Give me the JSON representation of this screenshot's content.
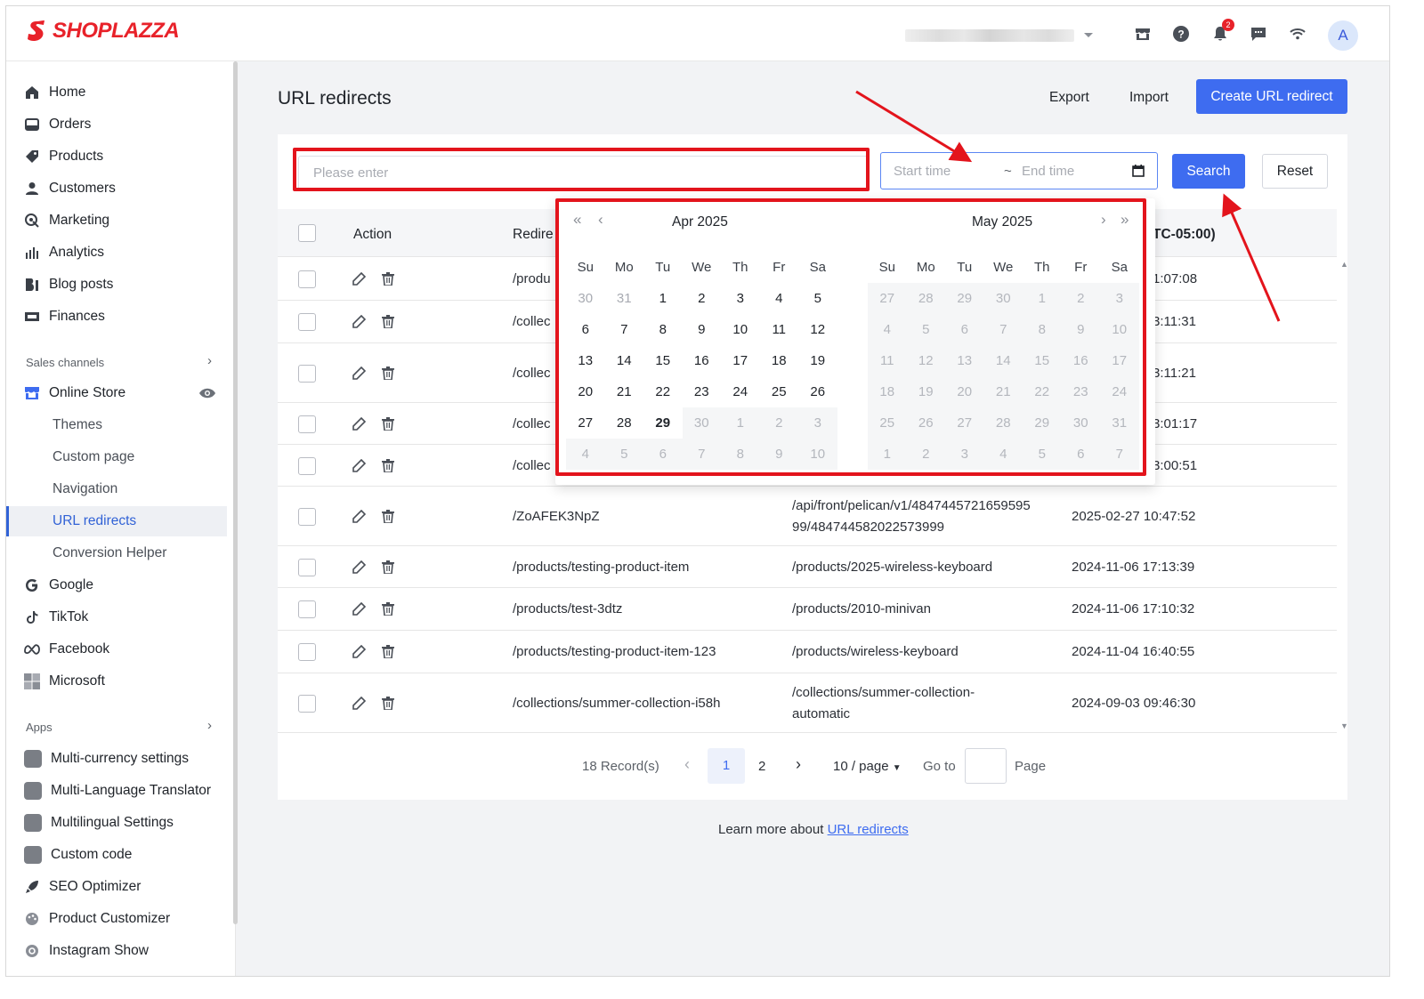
{
  "brand": {
    "name": "SHOPLAZZA",
    "color": "#e8222a"
  },
  "topbar": {
    "store_name": "",
    "notification_count": "2",
    "avatar_initial": "A",
    "icons": [
      "store-icon",
      "help-icon",
      "bell-icon",
      "chat-icon",
      "wifi-icon"
    ]
  },
  "sidebar": {
    "main_items": [
      {
        "label": "Home",
        "icon": "home-icon"
      },
      {
        "label": "Orders",
        "icon": "orders-icon"
      },
      {
        "label": "Products",
        "icon": "tag-icon"
      },
      {
        "label": "Customers",
        "icon": "person-icon"
      },
      {
        "label": "Marketing",
        "icon": "marketing-icon"
      },
      {
        "label": "Analytics",
        "icon": "bar-chart-icon"
      },
      {
        "label": "Blog posts",
        "icon": "blog-icon"
      },
      {
        "label": "Finances",
        "icon": "finance-icon"
      }
    ],
    "sales_channels_label": "Sales channels",
    "online_store_label": "Online Store",
    "online_store_sub": [
      "Themes",
      "Custom page",
      "Navigation",
      "URL redirects",
      "Conversion Helper"
    ],
    "active_sub": "URL redirects",
    "channels": [
      {
        "label": "Google",
        "icon": "google-icon"
      },
      {
        "label": "TikTok",
        "icon": "tiktok-icon"
      },
      {
        "label": "Facebook",
        "icon": "meta-icon"
      },
      {
        "label": "Microsoft",
        "icon": "microsoft-icon"
      }
    ],
    "apps_label": "Apps",
    "apps": [
      "Multi-currency settings",
      "Multi-Language Translator",
      "Multilingual Settings",
      "Custom code",
      "SEO Optimizer",
      "Product Customizer",
      "Instagram Show"
    ]
  },
  "page": {
    "title": "URL redirects",
    "export_label": "Export",
    "import_label": "Import",
    "create_label": "Create URL redirect"
  },
  "filters": {
    "search_placeholder": "Please enter",
    "start_placeholder": "Start time",
    "range_sep": "~",
    "end_placeholder": "End time",
    "search_label": "Search",
    "reset_label": "Reset"
  },
  "table": {
    "headers": {
      "action": "Action",
      "redirect_from": "Redire",
      "created": "TC-05:00)"
    },
    "rows": [
      {
        "from": "/produ",
        "to": "",
        "time": "1:07:08"
      },
      {
        "from": "/collec",
        "to": "",
        "time": "3:11:31"
      },
      {
        "from": "/collec",
        "to": "",
        "time": "3:11:21"
      },
      {
        "from": "/collec",
        "to": "",
        "time": "3:01:17"
      },
      {
        "from": "/collec",
        "to": "",
        "time": "3:00:51"
      },
      {
        "from": "/ZoAFEK3NpZ",
        "to": "/api/front/pelican/v1/484744572165959599/484744582022573999",
        "to_line1": "/api/front/pelican/v1/4847445721659595",
        "to_line2": "99/484744582022573999",
        "time": "2025-02-27 10:47:52"
      },
      {
        "from": "/products/testing-product-item",
        "to": "/products/2025-wireless-keyboard",
        "time": "2024-11-06 17:13:39"
      },
      {
        "from": "/products/test-3dtz",
        "to": "/products/2010-minivan",
        "time": "2024-11-06 17:10:32"
      },
      {
        "from": "/products/testing-product-item-123",
        "to": "/products/wireless-keyboard",
        "time": "2024-11-04 16:40:55"
      },
      {
        "from": "/collections/summer-collection-i58h",
        "to": "/collections/summer-collection-automatic",
        "to_line1": "/collections/summer-collection-",
        "to_line2": "automatic",
        "time": "2024-09-03 09:46:30"
      }
    ]
  },
  "pagination": {
    "records": "18 Record(s)",
    "pages": [
      "1",
      "2"
    ],
    "current_page": "1",
    "page_size": "10 / page",
    "goto_label": "Go to",
    "page_label": "Page"
  },
  "footer": {
    "text": "Learn more about",
    "link": "URL redirects"
  },
  "calendar": {
    "left": {
      "title": "Apr  2025",
      "weekdays": [
        "Su",
        "Mo",
        "Tu",
        "We",
        "Th",
        "Fr",
        "Sa"
      ],
      "days": [
        "30",
        "31",
        "1",
        "2",
        "3",
        "4",
        "5",
        "6",
        "7",
        "8",
        "9",
        "10",
        "11",
        "12",
        "13",
        "14",
        "15",
        "16",
        "17",
        "18",
        "19",
        "20",
        "21",
        "22",
        "23",
        "24",
        "25",
        "26",
        "27",
        "28",
        "29",
        "30",
        "1",
        "2",
        "3",
        "4",
        "5",
        "6",
        "7",
        "8",
        "9",
        "10"
      ],
      "today": "29"
    },
    "right": {
      "title": "May  2025",
      "weekdays": [
        "Su",
        "Mo",
        "Tu",
        "We",
        "Th",
        "Fr",
        "Sa"
      ],
      "days": [
        "27",
        "28",
        "29",
        "30",
        "1",
        "2",
        "3",
        "4",
        "5",
        "6",
        "7",
        "8",
        "9",
        "10",
        "11",
        "12",
        "13",
        "14",
        "15",
        "16",
        "17",
        "18",
        "19",
        "20",
        "21",
        "22",
        "23",
        "24",
        "25",
        "26",
        "27",
        "28",
        "29",
        "30",
        "31",
        "1",
        "2",
        "3",
        "4",
        "5",
        "6",
        "7"
      ]
    }
  },
  "colors": {
    "primary": "#3e6cf0",
    "annotation": "#e3141c",
    "active_nav": "#3162d6"
  }
}
